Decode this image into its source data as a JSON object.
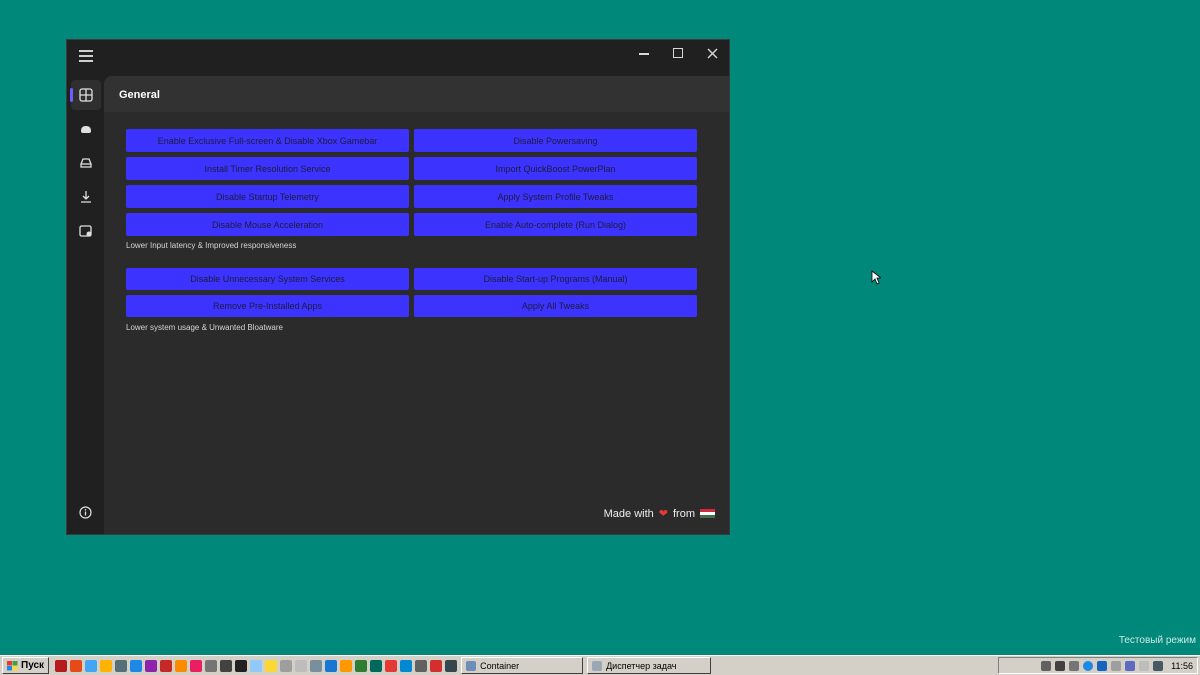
{
  "window": {
    "header_title": "General"
  },
  "section1": {
    "buttons": [
      "Enable Exclusive Full-screen & Disable Xbox Gamebar",
      "Disable Powersaving",
      "Install Timer Resolution Service",
      "Import QuickBoost PowerPlan",
      "Disable Startup Telemetry",
      "Apply System Profile Tweaks",
      "Disable Mouse Acceleration",
      "Enable Auto-complete (Run Dialog)"
    ],
    "caption": "Lower Input latency & Improved responsiveness"
  },
  "section2": {
    "buttons": [
      "Disable Unnecessary System Services",
      "Disable Start-up Programs (Manual)",
      "Remove Pre-Installed Apps",
      "Apply All Tweaks"
    ],
    "caption": "Lower system usage & Unwanted Bloatware"
  },
  "footer": {
    "made_with": "Made with",
    "from": "from"
  },
  "colors": {
    "desktop": "#00897b",
    "button": "#3d33ff",
    "accent": "#6d5cff",
    "heart": "#e53935"
  },
  "watermark": {
    "line1": "Тестовый режим"
  },
  "taskbar": {
    "start_label": "Пуск",
    "tasks": [
      "Container",
      "Диспетчер задач"
    ],
    "clock": "11:56"
  }
}
